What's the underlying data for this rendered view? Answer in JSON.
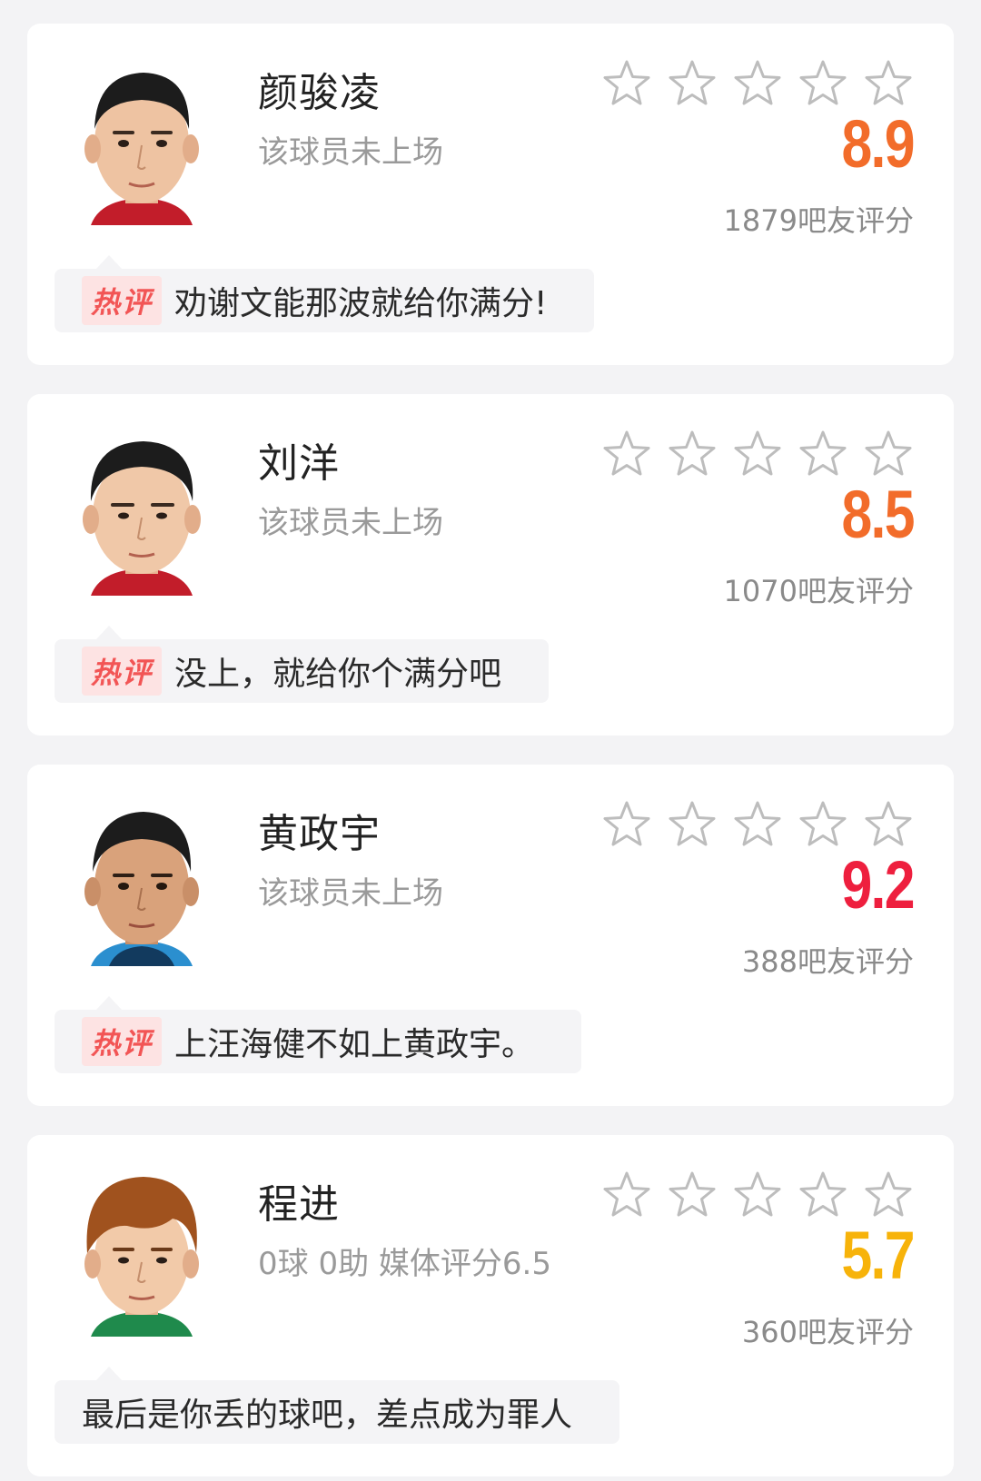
{
  "players": [
    {
      "name": "颜骏凌",
      "status": "该球员未上场",
      "score": "8.9",
      "score_color": "#f26c2a",
      "votes": "1879吧友评分",
      "stars_filled": 0,
      "hot_tag": "热评",
      "comment": "劝谢文能那波就给你满分!",
      "hair_color": "#1c1c1c",
      "shirt_color": "#c21d2a"
    },
    {
      "name": "刘洋",
      "status": "该球员未上场",
      "score": "8.5",
      "score_color": "#f26c2a",
      "votes": "1070吧友评分",
      "stars_filled": 0,
      "hot_tag": "热评",
      "comment": "没上，就给你个满分吧",
      "hair_color": "#1c1c1c",
      "shirt_color": "#c21d2a"
    },
    {
      "name": "黄政宇",
      "status": "该球员未上场",
      "score": "9.2",
      "score_color": "#ee1f3e",
      "votes": "388吧友评分",
      "stars_filled": 0,
      "hot_tag": "热评",
      "comment": "上汪海健不如上黄政宇。",
      "hair_color": "#1c1c1c",
      "shirt_color": "#2b8fcf"
    },
    {
      "name": "程进",
      "status": "0球 0助  媒体评分6.5",
      "score": "5.7",
      "score_color": "#f7b30a",
      "votes": "360吧友评分",
      "stars_filled": 0,
      "hot_tag": "",
      "comment": "最后是你丢的球吧，差点成为罪人",
      "hair_color": "#a0521e",
      "shirt_color": "#1f8a4c"
    }
  ],
  "star_icon": "star-outline-icon",
  "star_color": "#bdbdbd"
}
